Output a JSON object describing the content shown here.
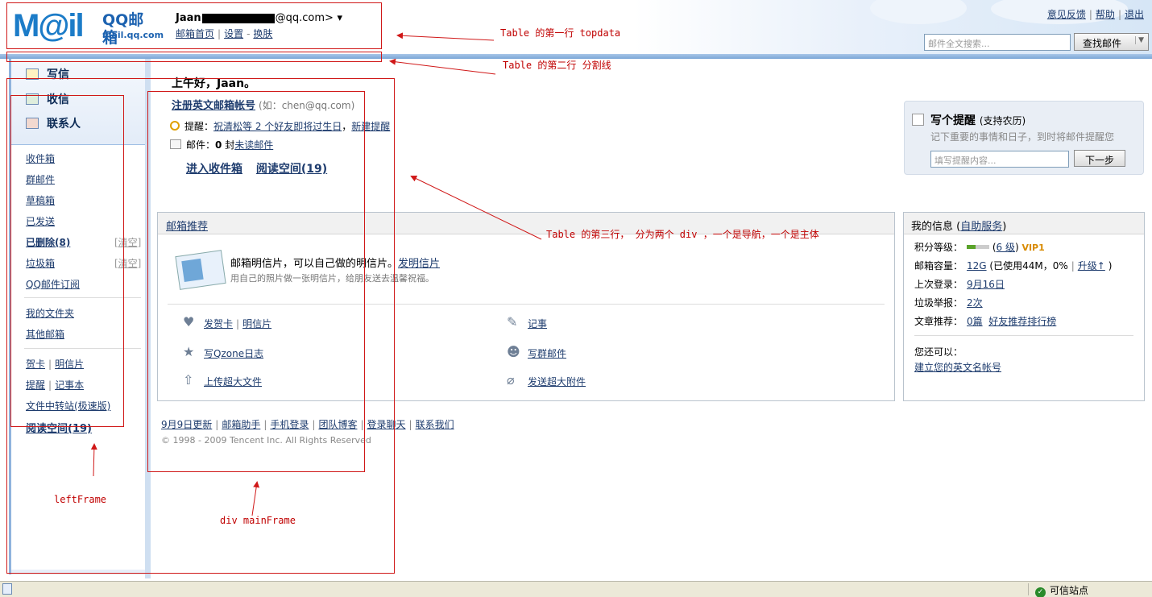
{
  "header": {
    "logo_mark": "M@il",
    "logo_title": "QQ邮箱",
    "logo_sub": "mail.qq.com",
    "user_prefix": "Jaan",
    "user_domain": "@qq.com>",
    "user_dropdown": "▾",
    "links": [
      "邮箱首页",
      "设置",
      "换肤"
    ],
    "right_links": [
      "意见反馈",
      "帮助",
      "退出"
    ],
    "search_placeholder": "邮件全文搜索...",
    "search_button": "查找邮件",
    "search_dropdown": "▼"
  },
  "sidebar": {
    "actions": [
      {
        "label": "写信",
        "icon": "pencil-icon"
      },
      {
        "label": "收信",
        "icon": "inbox-icon"
      },
      {
        "label": "联系人",
        "icon": "contacts-icon"
      }
    ],
    "folders": [
      "收件箱",
      "群邮件",
      "草稿箱",
      "已发送",
      "已删除(8)",
      "垃圾箱",
      "QQ邮件订阅"
    ],
    "clear_label": "[清空]",
    "my_folders": [
      "我的文件夹",
      "其他邮箱"
    ],
    "tools": {
      "row1": [
        "贺卡",
        "明信片"
      ],
      "row2": [
        "提醒",
        "记事本"
      ],
      "transfer": "文件中转站(极速版)",
      "reading": "阅读空间(19)"
    }
  },
  "main": {
    "greeting": "上午好，Jaan。",
    "register_link": "注册英文邮箱帐号",
    "register_hint": "(如：chen@qq.com)",
    "reminder_prefix": "提醒：",
    "reminder_link": "祝清松等 2 个好友即将过生日",
    "reminder_sep": "，",
    "reminder_new": "新建提醒",
    "mail_prefix": "邮件：",
    "mail_count": "0",
    "mail_unit": " 封",
    "mail_link": "未读邮件",
    "big_links": [
      "进入收件箱",
      "阅读空间(19)"
    ],
    "recommend": {
      "title": "邮箱推荐",
      "card_title": "邮箱明信片，可以自己做的明信片。",
      "card_link": "发明信片",
      "card_desc": "用自己的照片做一张明信片，给朋友送去温馨祝福。",
      "features": [
        {
          "links": [
            "发贺卡",
            "明信片"
          ],
          "icon": "heart-icon"
        },
        {
          "links": [
            "写Qzone日志"
          ],
          "icon": "star-icon"
        },
        {
          "links": [
            "上传超大文件"
          ],
          "icon": "upload-icon"
        },
        {
          "links": [
            "记事"
          ],
          "icon": "note-icon"
        },
        {
          "links": [
            "写群邮件"
          ],
          "icon": "group-icon"
        },
        {
          "links": [
            "发送超大附件"
          ],
          "icon": "paperclip-icon"
        }
      ]
    },
    "footer_links": [
      "9月9日更新",
      "邮箱助手",
      "手机登录",
      "团队博客",
      "登录聊天",
      "联系我们"
    ],
    "copyright": "© 1998 - 2009 Tencent Inc. All Rights Reserved"
  },
  "reminder_box": {
    "title": "写个提醒",
    "title_note": "(支持农历)",
    "desc": "记下重要的事情和日子，到时将邮件提醒您",
    "input_placeholder": "填写提醒内容...",
    "button": "下一步"
  },
  "info": {
    "title": "我的信息",
    "title_link": "自助服务",
    "level_label": "积分等级：",
    "level_value": "6 级",
    "vip": "VIP1",
    "capacity_label": "邮箱容量：",
    "capacity_value": "12G",
    "capacity_used": "(已使用44M，0%",
    "capacity_upgrade": "升级↑",
    "capacity_close": ")",
    "last_login_label": "上次登录：",
    "last_login_value": "9月16日",
    "spam_label": "垃圾举报：",
    "spam_value": "2次",
    "article_label": "文章推荐：",
    "article_value": "0篇",
    "article_rank": "好友推荐排行榜",
    "also_label": "您还可以：",
    "also_link": "建立您的英文名帐号"
  },
  "annotations": {
    "row1": "Table 的第一行  topdata",
    "row2": "Table 的第二行 分割线",
    "row3": "Table 的第三行， 分为两个 div ，一个是导航，一个是主体",
    "left": "leftFrame",
    "main": "div  mainFrame"
  },
  "statusbar": {
    "trust": "可信站点"
  }
}
